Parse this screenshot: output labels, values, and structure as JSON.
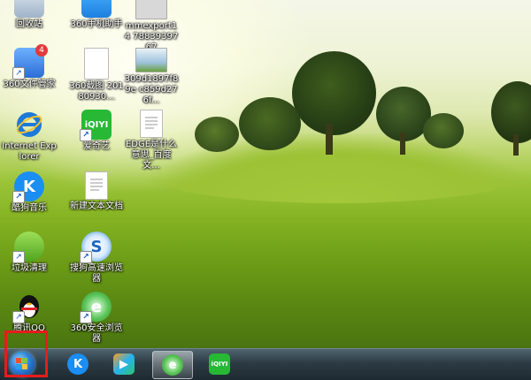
{
  "desktop": {
    "icons": [
      {
        "label": "回收站",
        "name": "recycle-bin-icon"
      },
      {
        "label": "360手机助手",
        "name": "360-phone-assistant-icon"
      },
      {
        "label": "mmexport14 7883939767",
        "name": "image-file-icon"
      },
      {
        "label": "360文件管家",
        "name": "360-file-manager-icon"
      },
      {
        "label": "360截图 20180930...",
        "name": "screenshot-file-icon"
      },
      {
        "label": "309d1897f89e c859d276f...",
        "name": "image-thumbnail-icon"
      },
      {
        "label": "Internet Explorer",
        "name": "internet-explorer-icon"
      },
      {
        "label": "爱奇艺",
        "name": "iqiyi-icon"
      },
      {
        "label": "EDGE是什么意思_百度文...",
        "name": "document-file-icon"
      },
      {
        "label": "酷狗音乐",
        "name": "kugou-music-icon"
      },
      {
        "label": "新建文本文档",
        "name": "text-document-icon"
      },
      {
        "label": "垃圾清理",
        "name": "trash-cleaner-icon"
      },
      {
        "label": "搜狗高速浏览器",
        "name": "sogou-browser-icon"
      },
      {
        "label": "腾讯QQ",
        "name": "qq-icon"
      },
      {
        "label": "360安全浏览器",
        "name": "360-browser-icon"
      }
    ],
    "badge_count": "4"
  },
  "taskbar": {
    "start": "start-orb",
    "pinned": [
      {
        "name": "kugou-taskbar-icon",
        "glyph": "K"
      },
      {
        "name": "tencent-video-taskbar-icon",
        "glyph": "▶"
      },
      {
        "name": "360-browser-taskbar-icon",
        "glyph": "e"
      },
      {
        "name": "iqiyi-taskbar-icon",
        "glyph": "iQIYI"
      }
    ]
  },
  "colors": {
    "highlight": "#e61c1c",
    "taskbar": "#2c3b44"
  }
}
